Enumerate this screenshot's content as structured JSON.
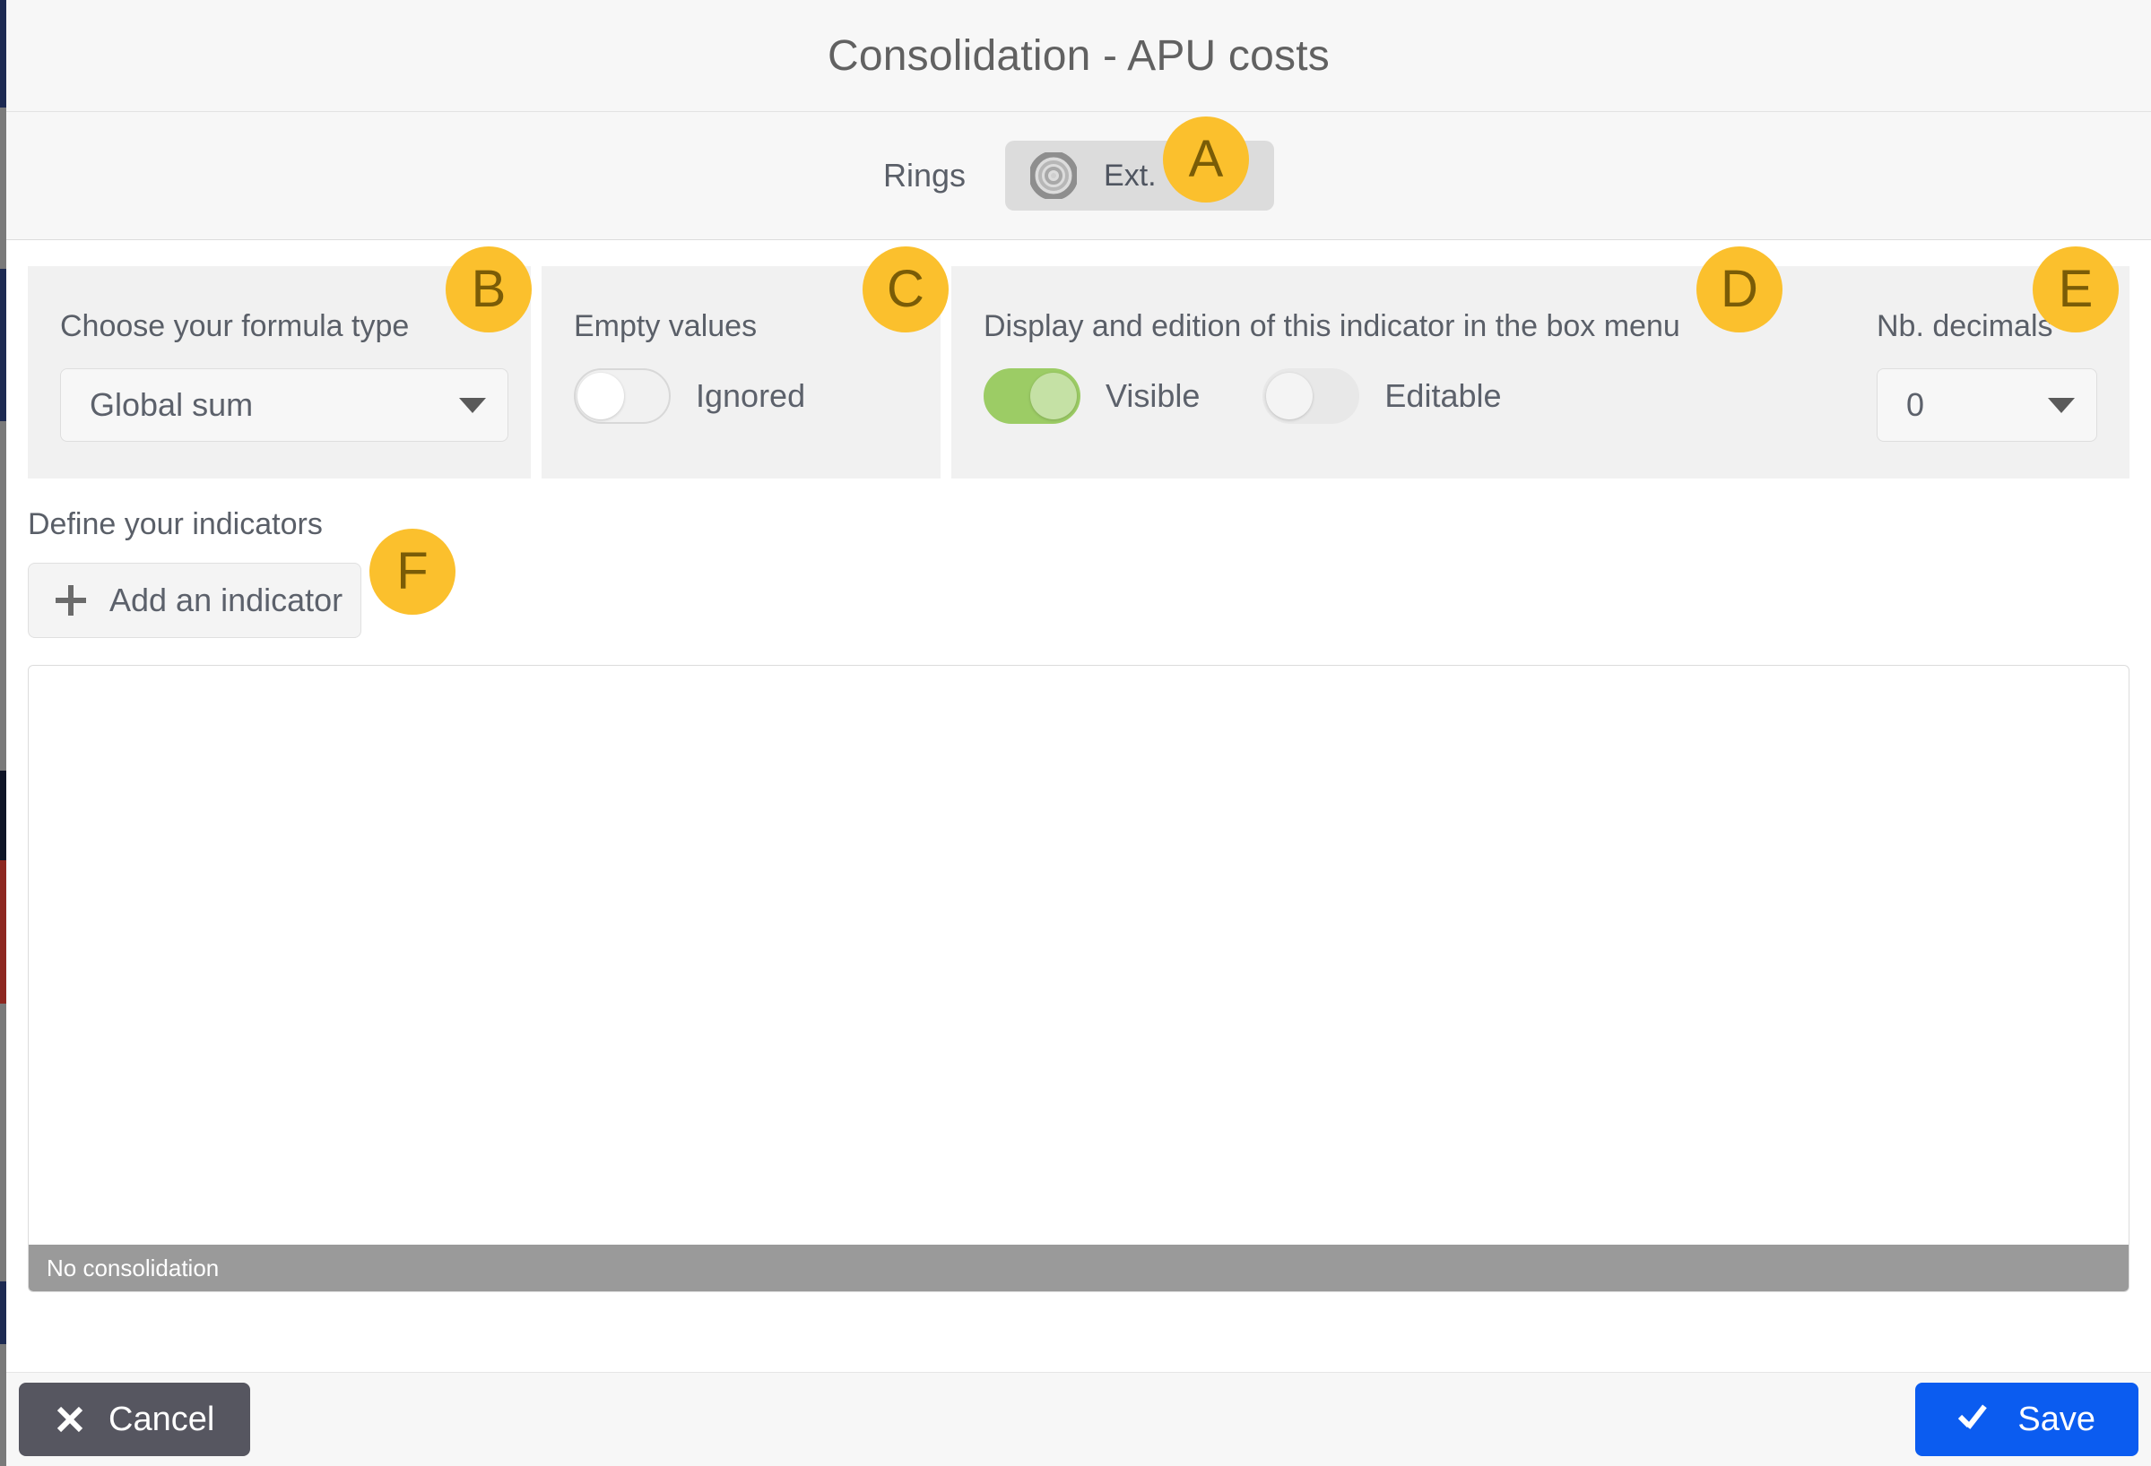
{
  "window": {
    "title": "Consolidation - APU costs"
  },
  "rings": {
    "label": "Rings",
    "chip": {
      "icon": "concentric-rings-icon",
      "text": "Ext."
    }
  },
  "annotations": [
    {
      "id": "A",
      "label": "A"
    },
    {
      "id": "B",
      "label": "B"
    },
    {
      "id": "C",
      "label": "C"
    },
    {
      "id": "D",
      "label": "D"
    },
    {
      "id": "E",
      "label": "E"
    },
    {
      "id": "F",
      "label": "F"
    }
  ],
  "formula": {
    "label": "Choose your formula type",
    "selected": "Global sum",
    "caret_icon": "chevron-down-icon"
  },
  "empty_values": {
    "label": "Empty values",
    "toggle": {
      "state": "off",
      "text": "Ignored"
    }
  },
  "display_edition": {
    "label": "Display and edition of this indicator in the box menu",
    "visible": {
      "state": "on",
      "text": "Visible"
    },
    "editable": {
      "state": "off",
      "text": "Editable"
    }
  },
  "decimals": {
    "label": "Nb. decimals",
    "selected": "0",
    "caret_icon": "chevron-down-icon"
  },
  "indicators": {
    "label": "Define your indicators",
    "add_button": {
      "icon": "plus-icon",
      "label": "Add an indicator"
    },
    "panel_status": "No consolidation"
  },
  "footer": {
    "cancel": {
      "icon": "close-icon",
      "label": "Cancel"
    },
    "save": {
      "icon": "check-icon",
      "label": "Save"
    }
  },
  "colors": {
    "accent_blue": "#0b5cf0",
    "toggle_on_green": "#9ccc65",
    "annotation_yellow": "#fbc02d",
    "status_bar_grey": "#9a9a9a",
    "cancel_grey": "#565660"
  }
}
